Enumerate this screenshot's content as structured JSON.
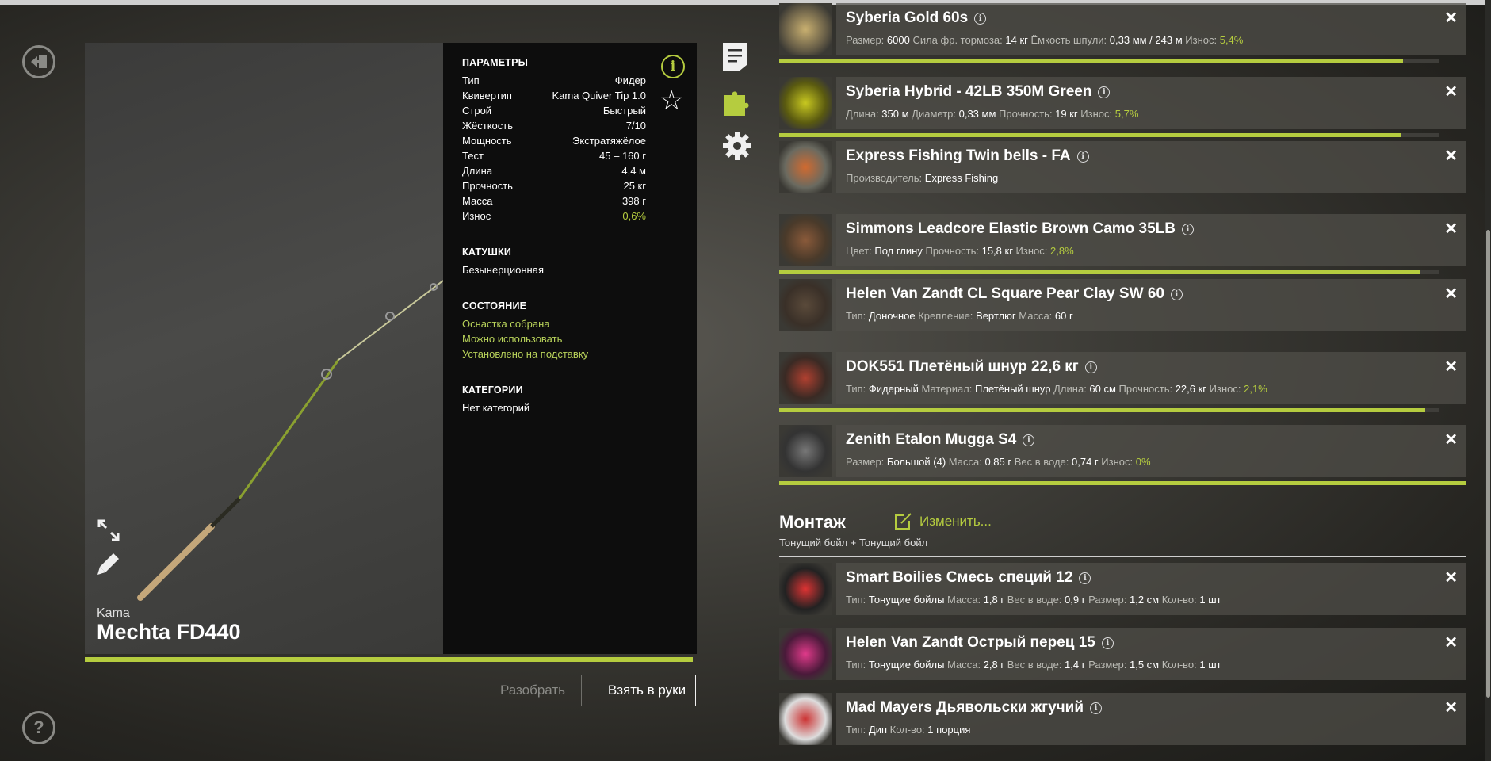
{
  "rod": {
    "brand": "Kama",
    "name": "Mechta FD440",
    "condition_fraction": 0.994
  },
  "params": {
    "title": "ПАРАМЕТРЫ",
    "rows": [
      {
        "label": "Тип",
        "value": "Фидер"
      },
      {
        "label": "Квивертип",
        "value": "Kama Quiver Tip 1.0"
      },
      {
        "label": "Строй",
        "value": "Быстрый"
      },
      {
        "label": "Жёсткость",
        "value": "7/10"
      },
      {
        "label": "Мощность",
        "value": "Экстратяжёлое"
      },
      {
        "label": "Тест",
        "value": "45 – 160 г"
      },
      {
        "label": "Длина",
        "value": "4,4 м"
      },
      {
        "label": "Прочность",
        "value": "25 кг"
      },
      {
        "label": "Масса",
        "value": "398 г"
      },
      {
        "label": "Износ",
        "value": "0,6%"
      }
    ],
    "reels_title": "КАТУШКИ",
    "reels_value": "Безынерционная",
    "state_title": "СОСТОЯНИЕ",
    "states": [
      "Оснастка собрана",
      "Можно использовать",
      "Установлено на подставку"
    ],
    "categories_title": "КАТЕГОРИИ",
    "categories_value": "Нет категорий"
  },
  "buttons": {
    "disassemble": "Разобрать",
    "take": "Взять в руки"
  },
  "items": [
    {
      "title": "Syberia Gold 60s",
      "desc": [
        [
          "Размер: ",
          "6000"
        ],
        [
          " Сила фр. тормоза: ",
          "14 кг"
        ],
        [
          " Ёмкость шпули: ",
          "0,33 мм / 243 м"
        ],
        [
          " Износ: ",
          "5,4%",
          "g"
        ]
      ]
    },
    {
      "title": "Syberia Hybrid - 42LB 350M Green",
      "desc": [
        [
          "Длина: ",
          "350 м"
        ],
        [
          " Диаметр: ",
          "0,33 мм"
        ],
        [
          " Прочность: ",
          "19 кг"
        ],
        [
          " Износ: ",
          "5,7%",
          "g"
        ]
      ]
    },
    {
      "title": "Express Fishing Twin bells - FA",
      "desc": [
        [
          "Производитель: ",
          "Express Fishing"
        ]
      ]
    },
    {
      "title": "Simmons Leadcore Elastic Brown Camo 35LB",
      "desc": [
        [
          "Цвет: ",
          "Под глину"
        ],
        [
          " Прочность: ",
          "15,8 кг"
        ],
        [
          " Износ: ",
          "2,8%",
          "g"
        ]
      ]
    },
    {
      "title": "Helen Van Zandt CL Square Pear Clay SW 60",
      "desc": [
        [
          "Тип: ",
          "Доночное"
        ],
        [
          " Крепление: ",
          "Вертлюг"
        ],
        [
          " Масса: ",
          "60 г"
        ]
      ]
    },
    {
      "title": "DOK551 Плетёный шнур 22,6 кг",
      "desc": [
        [
          "Тип: ",
          "Фидерный"
        ],
        [
          " Материал: ",
          "Плетёный шнур"
        ],
        [
          " Длина: ",
          "60 см"
        ],
        [
          " Прочность: ",
          "22,6 кг"
        ],
        [
          " Износ: ",
          "2,1%",
          "g"
        ]
      ]
    },
    {
      "title": "Zenith Etalon Mugga S4",
      "desc": [
        [
          "Размер: ",
          "Большой (4)"
        ],
        [
          " Масса: ",
          "0,85 г"
        ],
        [
          " Вес в воде: ",
          "0,74 г"
        ],
        [
          " Износ: ",
          "0%",
          "g"
        ]
      ]
    },
    {
      "title": "Smart Boilies Смесь специй 12",
      "desc": [
        [
          "Тип: ",
          "Тонущие бойлы"
        ],
        [
          " Масса: ",
          "1,8 г"
        ],
        [
          " Вес в воде: ",
          "0,9 г"
        ],
        [
          " Размер: ",
          "1,2 см"
        ],
        [
          " Кол-во: ",
          "1 шт"
        ]
      ]
    },
    {
      "title": "Helen Van Zandt Острый перец 15",
      "desc": [
        [
          "Тип: ",
          "Тонущие бойлы"
        ],
        [
          " Масса: ",
          "2,8 г"
        ],
        [
          " Вес в воде: ",
          "1,4 г"
        ],
        [
          " Размер: ",
          "1,5 см"
        ],
        [
          " Кол-во: ",
          "1 шт"
        ]
      ]
    },
    {
      "title": "Mad Mayers Дьявольски жгучий",
      "desc": [
        [
          "Тип: ",
          "Дип"
        ],
        [
          " Кол-во: ",
          "1 порция"
        ]
      ]
    }
  ],
  "wear_fractions": [
    0.946,
    0.943,
    0.972,
    0.979,
    1.0
  ],
  "montage": {
    "title": "Монтаж",
    "edit_label": "Изменить...",
    "subtitle": "Тонущий бойл  +  Тонущий бойл"
  },
  "colors": {
    "accent": "#b5cc3f"
  },
  "icons": [
    "exit-icon",
    "help-icon",
    "notes-icon",
    "puzzle-icon",
    "gear-icon",
    "info-icon",
    "star-icon",
    "expand-icon",
    "pencil-icon",
    "close-icon"
  ]
}
